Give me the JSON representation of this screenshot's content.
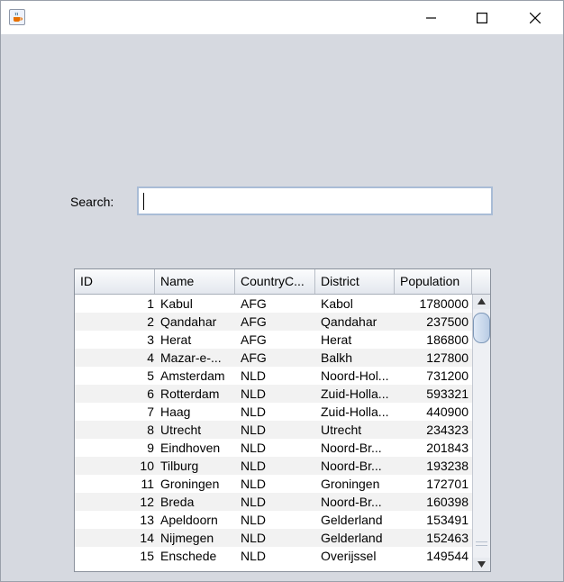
{
  "window": {
    "icon": "java-cup-icon",
    "controls": [
      "minimize-icon",
      "maximize-icon",
      "close-icon"
    ]
  },
  "search": {
    "label": "Search:",
    "value": ""
  },
  "table": {
    "columns": [
      "ID",
      "Name",
      "CountryC...",
      "District",
      "Population"
    ],
    "rows": [
      {
        "id": "1",
        "name": "Kabul",
        "country": "AFG",
        "district": "Kabol",
        "population": "1780000"
      },
      {
        "id": "2",
        "name": "Qandahar",
        "country": "AFG",
        "district": "Qandahar",
        "population": "237500"
      },
      {
        "id": "3",
        "name": "Herat",
        "country": "AFG",
        "district": "Herat",
        "population": "186800"
      },
      {
        "id": "4",
        "name": "Mazar-e-...",
        "country": "AFG",
        "district": "Balkh",
        "population": "127800"
      },
      {
        "id": "5",
        "name": "Amsterdam",
        "country": "NLD",
        "district": "Noord-Hol...",
        "population": "731200"
      },
      {
        "id": "6",
        "name": "Rotterdam",
        "country": "NLD",
        "district": "Zuid-Holla...",
        "population": "593321"
      },
      {
        "id": "7",
        "name": "Haag",
        "country": "NLD",
        "district": "Zuid-Holla...",
        "population": "440900"
      },
      {
        "id": "8",
        "name": "Utrecht",
        "country": "NLD",
        "district": "Utrecht",
        "population": "234323"
      },
      {
        "id": "9",
        "name": "Eindhoven",
        "country": "NLD",
        "district": "Noord-Br...",
        "population": "201843"
      },
      {
        "id": "10",
        "name": "Tilburg",
        "country": "NLD",
        "district": "Noord-Br...",
        "population": "193238"
      },
      {
        "id": "11",
        "name": "Groningen",
        "country": "NLD",
        "district": "Groningen",
        "population": "172701"
      },
      {
        "id": "12",
        "name": "Breda",
        "country": "NLD",
        "district": "Noord-Br...",
        "population": "160398"
      },
      {
        "id": "13",
        "name": "Apeldoorn",
        "country": "NLD",
        "district": "Gelderland",
        "population": "153491"
      },
      {
        "id": "14",
        "name": "Nijmegen",
        "country": "NLD",
        "district": "Gelderland",
        "population": "152463"
      },
      {
        "id": "15",
        "name": "Enschede",
        "country": "NLD",
        "district": "Overijssel",
        "population": "149544"
      }
    ]
  },
  "scrollbar": {
    "up_icon": "arrow-up-icon",
    "down_icon": "arrow-down-icon"
  }
}
